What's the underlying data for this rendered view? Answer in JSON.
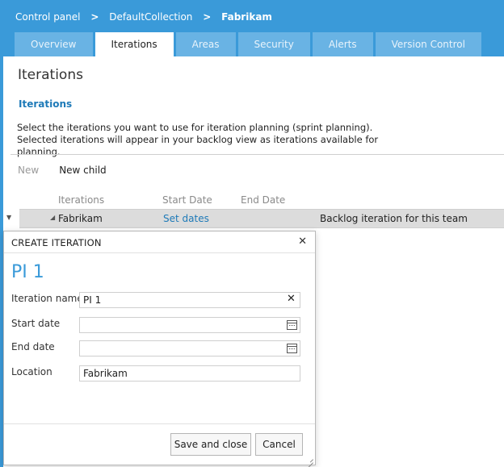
{
  "breadcrumb": {
    "root": "Control panel",
    "collection": "DefaultCollection",
    "separator": ">",
    "current": "Fabrikam"
  },
  "tabs": [
    {
      "label": "Overview",
      "active": false
    },
    {
      "label": "Iterations",
      "active": true
    },
    {
      "label": "Areas",
      "active": false
    },
    {
      "label": "Security",
      "active": false
    },
    {
      "label": "Alerts",
      "active": false
    },
    {
      "label": "Version Control",
      "active": false
    }
  ],
  "page": {
    "title": "Iterations",
    "section_link": "Iterations",
    "description": "Select the iterations you want to use for iteration planning (sprint planning). Selected iterations will appear in your backlog view as iterations available for planning."
  },
  "toolbar": {
    "new_label": "New",
    "new_child_label": "New child"
  },
  "grid": {
    "columns": [
      "Iterations",
      "Start Date",
      "End Date"
    ],
    "rows": [
      {
        "name": "Fabrikam",
        "dates_link": "Set dates",
        "note": "Backlog iteration for this team"
      }
    ]
  },
  "dialog": {
    "title": "CREATE ITERATION",
    "heading": "PI 1",
    "fields": {
      "iteration_name": {
        "label": "Iteration name",
        "value": "PI 1"
      },
      "start_date": {
        "label": "Start date",
        "value": ""
      },
      "end_date": {
        "label": "End date",
        "value": ""
      },
      "location": {
        "label": "Location",
        "value": "Fabrikam"
      }
    },
    "save_label": "Save and close",
    "cancel_label": "Cancel"
  },
  "icons": {
    "close": "close-icon",
    "clear": "clear-icon",
    "calendar": "calendar-icon",
    "expander": "triangle-down-icon"
  },
  "colors": {
    "header_blue": "#3a9ad9",
    "inactive_tab": "#69b3e4",
    "link_blue": "#1e7ab8",
    "selected_row": "#dcdcdc"
  }
}
